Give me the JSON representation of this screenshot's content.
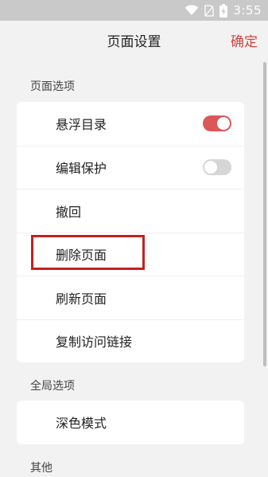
{
  "status_bar": {
    "time": "3:55"
  },
  "header": {
    "title": "页面设置",
    "confirm_label": "确定"
  },
  "sections": {
    "page_options": {
      "label": "页面选项",
      "items": {
        "floating_toc": {
          "label": "悬浮目录",
          "toggle": true
        },
        "edit_protect": {
          "label": "编辑保护",
          "toggle": false
        },
        "undo": {
          "label": "撤回"
        },
        "delete_page": {
          "label": "删除页面"
        },
        "refresh_page": {
          "label": "刷新页面"
        },
        "copy_link": {
          "label": "复制访问链接"
        }
      }
    },
    "global_options": {
      "label": "全局选项",
      "items": {
        "dark_mode": {
          "label": "深色模式"
        }
      }
    },
    "other": {
      "label": "其他"
    }
  },
  "colors": {
    "accent": "#d0443f",
    "highlight": "#c81e1e",
    "toggle_on": "#d9585a"
  }
}
